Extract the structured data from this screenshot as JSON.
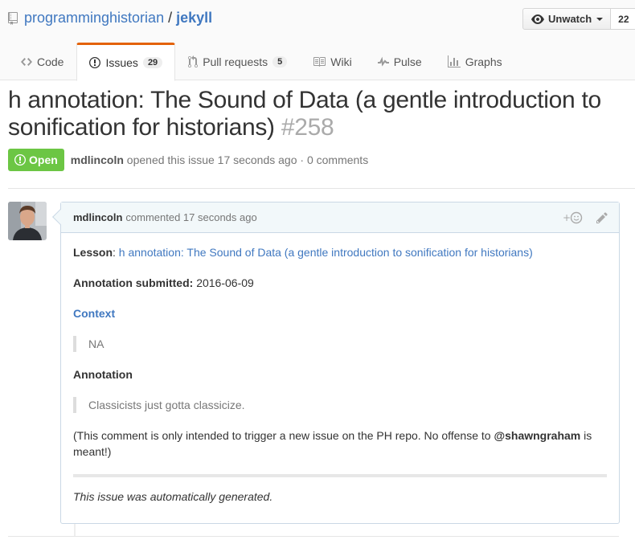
{
  "repo": {
    "owner": "programminghistorian",
    "separator": "/",
    "name": "jekyll",
    "watch_label": "Unwatch",
    "watch_count": "22"
  },
  "tabs": [
    {
      "label": "Code",
      "icon": "code-icon"
    },
    {
      "label": "Issues",
      "icon": "issue-opened-icon",
      "count": "29"
    },
    {
      "label": "Pull requests",
      "icon": "pull-request-icon",
      "count": "5"
    },
    {
      "label": "Wiki",
      "icon": "book-icon"
    },
    {
      "label": "Pulse",
      "icon": "pulse-icon"
    },
    {
      "label": "Graphs",
      "icon": "graph-icon"
    }
  ],
  "issue": {
    "title": "h annotation: The Sound of Data (a gentle introduction to sonification for historians)",
    "number": "#258",
    "state": "Open",
    "author": "mdlincoln",
    "meta_rest": "opened this issue 17 seconds ago · 0 comments"
  },
  "comment": {
    "author": "mdlincoln",
    "header_rest": "commented 17 seconds ago",
    "lesson_label": "Lesson",
    "lesson_colon": ":",
    "lesson_link": "h annotation: The Sound of Data (a gentle introduction to sonification for historians)",
    "submitted_label": "Annotation submitted:",
    "submitted_value": "2016-06-09",
    "context_heading": "Context",
    "context_quote": "NA",
    "annotation_heading": "Annotation",
    "annotation_quote": "Classicists just gotta classicize.",
    "note_before": "(This comment is only intended to trigger a new issue on the PH repo. No offense to",
    "note_mention": "@shawngraham",
    "note_after": "is meant!)",
    "footer": "This issue was automatically generated."
  },
  "colors": {
    "link": "#4078c0",
    "open_state": "#6cc644",
    "active_tab_accent": "#e36209"
  }
}
